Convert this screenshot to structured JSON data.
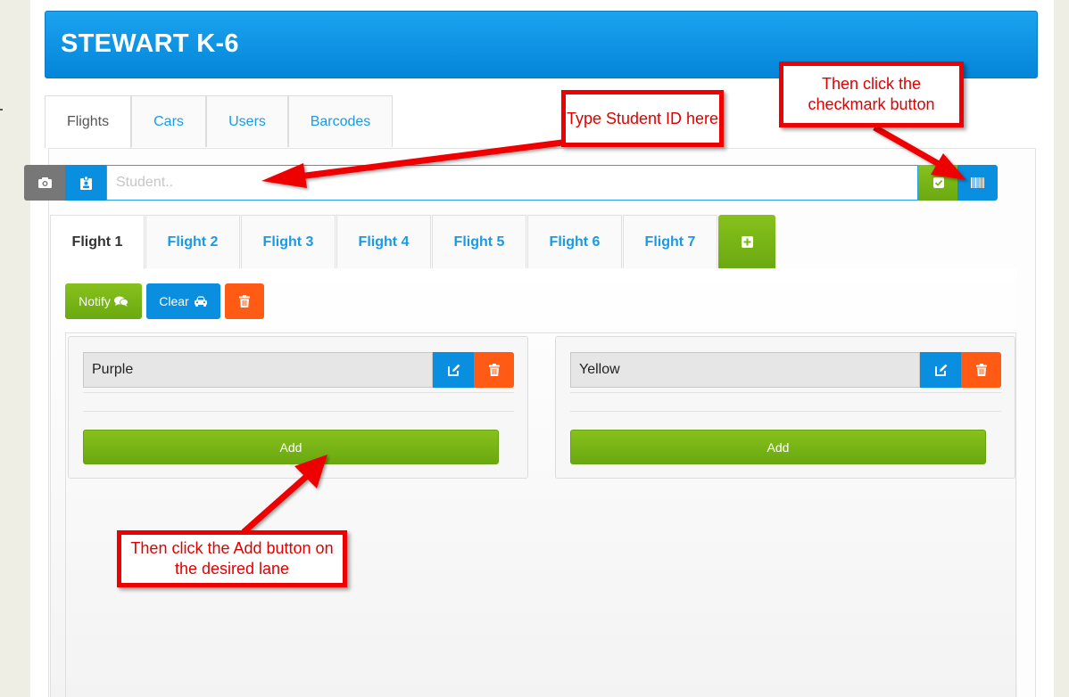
{
  "header": {
    "title": "STEWART K-6"
  },
  "main_tabs": [
    {
      "label": "Flights",
      "active": true
    },
    {
      "label": "Cars",
      "active": false
    },
    {
      "label": "Users",
      "active": false
    },
    {
      "label": "Barcodes",
      "active": false
    }
  ],
  "scanner": {
    "camera_icon": "camera-icon",
    "id_card_icon": "id-badge-icon",
    "student_placeholder": "Student..",
    "student_value": "",
    "check_icon": "check-square-icon",
    "barcode_icon": "barcode-icon"
  },
  "flight_tabs": [
    {
      "label": "Flight 1",
      "active": true
    },
    {
      "label": "Flight 2",
      "active": false
    },
    {
      "label": "Flight 3",
      "active": false
    },
    {
      "label": "Flight 4",
      "active": false
    },
    {
      "label": "Flight 5",
      "active": false
    },
    {
      "label": "Flight 6",
      "active": false
    },
    {
      "label": "Flight 7",
      "active": false
    }
  ],
  "actions": {
    "notify_label": "Notify",
    "clear_label": "Clear"
  },
  "lanes": [
    {
      "name": "Purple",
      "add_label": "Add"
    },
    {
      "name": "Yellow",
      "add_label": "Add"
    }
  ],
  "annotations": {
    "type_student_id": "Type Student ID here",
    "click_checkmark": "Then click the checkmark button",
    "click_add": "Then click the Add button on the desired lane"
  },
  "colors": {
    "header_blue": "#0a8ee0",
    "tab_link_blue": "#1a9ae5",
    "green": "#7ab51a",
    "orange": "#ff5b14",
    "callout_red": "#ef0000"
  }
}
